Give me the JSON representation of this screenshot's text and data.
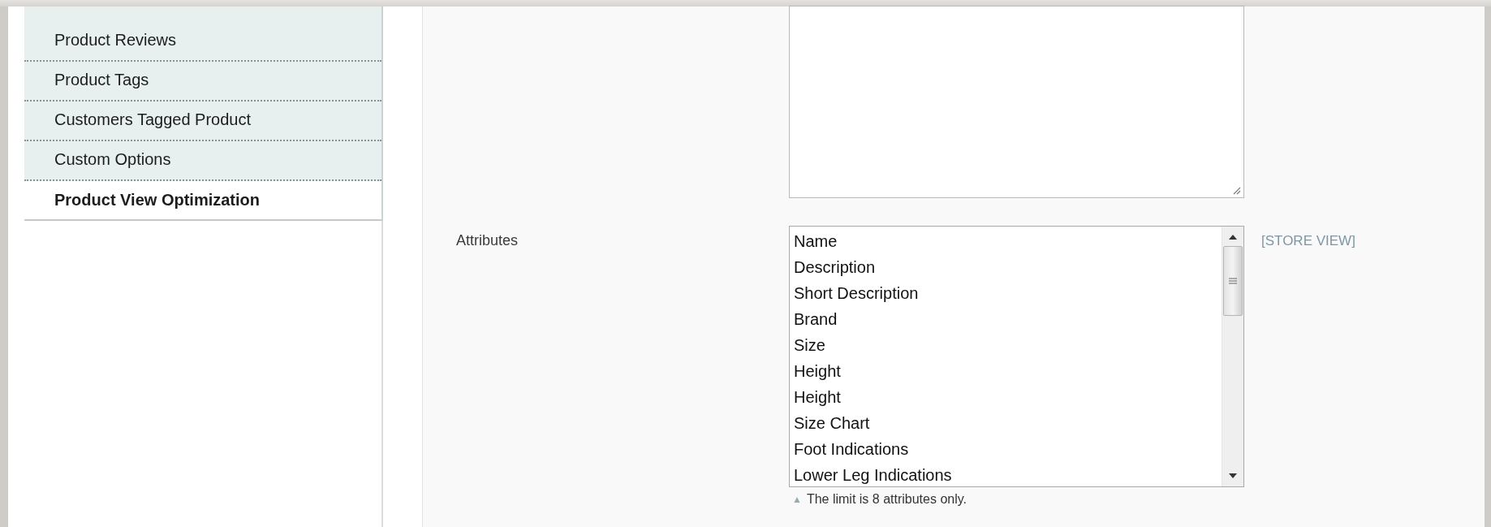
{
  "sidebar": {
    "tabs": [
      {
        "label": "Product Reviews",
        "selected": false
      },
      {
        "label": "Product Tags",
        "selected": false
      },
      {
        "label": "Customers Tagged Product",
        "selected": false
      },
      {
        "label": "Custom Options",
        "selected": false
      },
      {
        "label": "Product View Optimization",
        "selected": true
      }
    ]
  },
  "form": {
    "fields": [
      {
        "kind": "textarea"
      },
      {
        "kind": "multiselect",
        "label": "Attributes",
        "scope": "[STORE VIEW]",
        "note": "The limit is 8 attributes only.",
        "note_icon": "▲",
        "options": [
          {
            "label": "Name",
            "selected": false
          },
          {
            "label": "Description",
            "selected": false
          },
          {
            "label": "Short Description",
            "selected": false
          },
          {
            "label": "Brand",
            "selected": false
          },
          {
            "label": "Size",
            "selected": false
          },
          {
            "label": "Height",
            "selected": false
          },
          {
            "label": "Height",
            "selected": false
          },
          {
            "label": "Size Chart",
            "selected": false
          },
          {
            "label": "Foot Indications",
            "selected": false
          },
          {
            "label": "Lower Leg Indications",
            "selected": false
          }
        ]
      }
    ]
  }
}
